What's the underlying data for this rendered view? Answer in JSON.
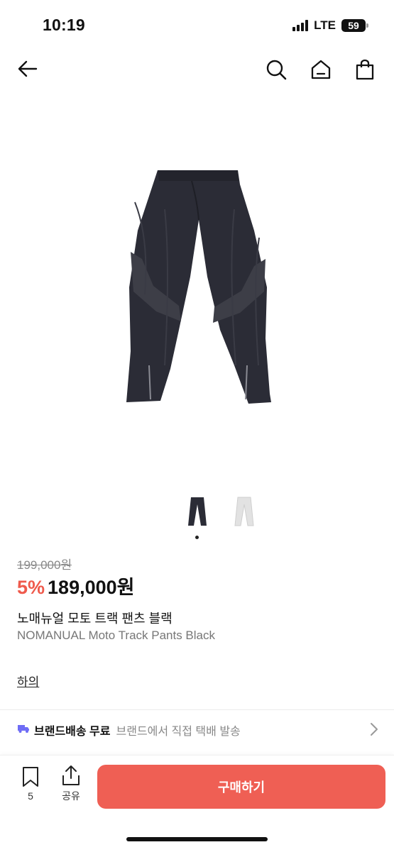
{
  "status_bar": {
    "time": "10:19",
    "network": "LTE",
    "battery": "59"
  },
  "header": {
    "back_icon": "arrow-left-icon",
    "search_icon": "search-icon",
    "home_icon": "home-icon",
    "bag_icon": "shopping-bag-icon"
  },
  "gallery": {
    "thumbnails": [
      "black",
      "white"
    ],
    "active_index": 0
  },
  "price": {
    "original": "199,000원",
    "discount": "5%",
    "current": "189,000원"
  },
  "product": {
    "name_ko": "노매뉴얼 모토 트랙 팬츠 블랙",
    "name_en": "NOMANUAL Moto Track Pants Black",
    "category": "하의"
  },
  "shipping": {
    "title": "브랜드배송 무료",
    "subtitle": "브랜드에서 직접 택배 발송"
  },
  "bottom_bar": {
    "bookmark_count": "5",
    "share_label": "공유",
    "buy_label": "구매하기"
  },
  "colors": {
    "accent": "#ef5f54",
    "discount": "#ef5a4c",
    "ship_icon": "#6e6cf5"
  }
}
